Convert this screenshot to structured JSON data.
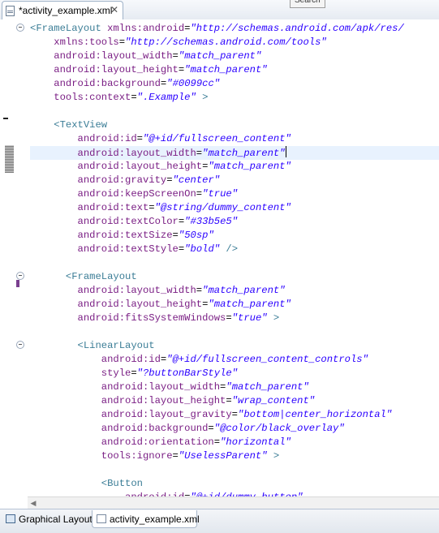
{
  "editor_tab": {
    "title": "*activity_example.xml",
    "close_glyph": "✕"
  },
  "search_tooltip": "Search",
  "code_lines": [
    [
      {
        "t": "tag",
        "v": "<FrameLayout "
      },
      {
        "t": "attr",
        "v": "xmlns:android"
      },
      {
        "t": "eq",
        "v": "="
      },
      {
        "t": "val",
        "v": "\"http://schemas.android.com/apk/res/"
      }
    ],
    [
      {
        "t": "sp",
        "v": "    "
      },
      {
        "t": "attr",
        "v": "xmlns:tools"
      },
      {
        "t": "eq",
        "v": "="
      },
      {
        "t": "val",
        "v": "\"http://schemas.android.com/tools\""
      }
    ],
    [
      {
        "t": "sp",
        "v": "    "
      },
      {
        "t": "attr",
        "v": "android:layout_width"
      },
      {
        "t": "eq",
        "v": "="
      },
      {
        "t": "val",
        "v": "\"match_parent\""
      }
    ],
    [
      {
        "t": "sp",
        "v": "    "
      },
      {
        "t": "attr",
        "v": "android:layout_height"
      },
      {
        "t": "eq",
        "v": "="
      },
      {
        "t": "val",
        "v": "\"match_parent\""
      }
    ],
    [
      {
        "t": "sp",
        "v": "    "
      },
      {
        "t": "attr",
        "v": "android:background"
      },
      {
        "t": "eq",
        "v": "="
      },
      {
        "t": "val",
        "v": "\"#0099cc\""
      }
    ],
    [
      {
        "t": "sp",
        "v": "    "
      },
      {
        "t": "attr",
        "v": "tools:context"
      },
      {
        "t": "eq",
        "v": "="
      },
      {
        "t": "val",
        "v": "\".Example\""
      },
      {
        "t": "tag",
        "v": " >"
      }
    ],
    [],
    [
      {
        "t": "sp",
        "v": "    "
      },
      {
        "t": "tag",
        "v": "<TextView"
      }
    ],
    [
      {
        "t": "sp",
        "v": "        "
      },
      {
        "t": "attr",
        "v": "android:id"
      },
      {
        "t": "eq",
        "v": "="
      },
      {
        "t": "val",
        "v": "\"@+id/fullscreen_content\""
      }
    ],
    [
      {
        "t": "sp",
        "v": "        "
      },
      {
        "t": "attr",
        "v": "android:layout_width"
      },
      {
        "t": "eq",
        "v": "="
      },
      {
        "t": "val",
        "v": "\"match_parent\""
      },
      {
        "t": "caret",
        "v": ""
      }
    ],
    [
      {
        "t": "sp",
        "v": "        "
      },
      {
        "t": "attr",
        "v": "android:layout_height"
      },
      {
        "t": "eq",
        "v": "="
      },
      {
        "t": "val",
        "v": "\"match_parent\""
      }
    ],
    [
      {
        "t": "sp",
        "v": "        "
      },
      {
        "t": "attr",
        "v": "android:gravity"
      },
      {
        "t": "eq",
        "v": "="
      },
      {
        "t": "val",
        "v": "\"center\""
      }
    ],
    [
      {
        "t": "sp",
        "v": "        "
      },
      {
        "t": "attr",
        "v": "android:keepScreenOn"
      },
      {
        "t": "eq",
        "v": "="
      },
      {
        "t": "val",
        "v": "\"true\""
      }
    ],
    [
      {
        "t": "sp",
        "v": "        "
      },
      {
        "t": "attr",
        "v": "android:text"
      },
      {
        "t": "eq",
        "v": "="
      },
      {
        "t": "val",
        "v": "\"@string/dummy_content\""
      }
    ],
    [
      {
        "t": "sp",
        "v": "        "
      },
      {
        "t": "attr",
        "v": "android:textColor"
      },
      {
        "t": "eq",
        "v": "="
      },
      {
        "t": "val",
        "v": "\"#33b5e5\""
      }
    ],
    [
      {
        "t": "sp",
        "v": "        "
      },
      {
        "t": "attr",
        "v": "android:textSize"
      },
      {
        "t": "eq",
        "v": "="
      },
      {
        "t": "val",
        "v": "\"50sp\""
      }
    ],
    [
      {
        "t": "sp",
        "v": "        "
      },
      {
        "t": "attr",
        "v": "android:textStyle"
      },
      {
        "t": "eq",
        "v": "="
      },
      {
        "t": "val",
        "v": "\"bold\""
      },
      {
        "t": "tag",
        "v": " />"
      }
    ],
    [],
    [
      {
        "t": "sp",
        "v": "      "
      },
      {
        "t": "tag",
        "v": "<FrameLayout"
      }
    ],
    [
      {
        "t": "sp",
        "v": "        "
      },
      {
        "t": "attr",
        "v": "android:layout_width"
      },
      {
        "t": "eq",
        "v": "="
      },
      {
        "t": "val",
        "v": "\"match_parent\""
      }
    ],
    [
      {
        "t": "sp",
        "v": "        "
      },
      {
        "t": "attr",
        "v": "android:layout_height"
      },
      {
        "t": "eq",
        "v": "="
      },
      {
        "t": "val",
        "v": "\"match_parent\""
      }
    ],
    [
      {
        "t": "sp",
        "v": "        "
      },
      {
        "t": "attr",
        "v": "android:fitsSystemWindows"
      },
      {
        "t": "eq",
        "v": "="
      },
      {
        "t": "val",
        "v": "\"true\""
      },
      {
        "t": "tag",
        "v": " >"
      }
    ],
    [],
    [
      {
        "t": "sp",
        "v": "        "
      },
      {
        "t": "tag",
        "v": "<LinearLayout"
      }
    ],
    [
      {
        "t": "sp",
        "v": "            "
      },
      {
        "t": "attr",
        "v": "android:id"
      },
      {
        "t": "eq",
        "v": "="
      },
      {
        "t": "val",
        "v": "\"@+id/fullscreen_content_controls\""
      }
    ],
    [
      {
        "t": "sp",
        "v": "            "
      },
      {
        "t": "attr",
        "v": "style"
      },
      {
        "t": "eq",
        "v": "="
      },
      {
        "t": "val",
        "v": "\"?buttonBarStyle\""
      }
    ],
    [
      {
        "t": "sp",
        "v": "            "
      },
      {
        "t": "attr",
        "v": "android:layout_width"
      },
      {
        "t": "eq",
        "v": "="
      },
      {
        "t": "val",
        "v": "\"match_parent\""
      }
    ],
    [
      {
        "t": "sp",
        "v": "            "
      },
      {
        "t": "attr",
        "v": "android:layout_height"
      },
      {
        "t": "eq",
        "v": "="
      },
      {
        "t": "val",
        "v": "\"wrap_content\""
      }
    ],
    [
      {
        "t": "sp",
        "v": "            "
      },
      {
        "t": "attr",
        "v": "android:layout_gravity"
      },
      {
        "t": "eq",
        "v": "="
      },
      {
        "t": "val",
        "v": "\"bottom|center_horizontal\""
      }
    ],
    [
      {
        "t": "sp",
        "v": "            "
      },
      {
        "t": "attr",
        "v": "android:background"
      },
      {
        "t": "eq",
        "v": "="
      },
      {
        "t": "val",
        "v": "\"@color/black_overlay\""
      }
    ],
    [
      {
        "t": "sp",
        "v": "            "
      },
      {
        "t": "attr",
        "v": "android:orientation"
      },
      {
        "t": "eq",
        "v": "="
      },
      {
        "t": "val",
        "v": "\"horizontal\""
      }
    ],
    [
      {
        "t": "sp",
        "v": "            "
      },
      {
        "t": "attr",
        "v": "tools:ignore"
      },
      {
        "t": "eq",
        "v": "="
      },
      {
        "t": "val",
        "v": "\"UselessParent\""
      },
      {
        "t": "tag",
        "v": " >"
      }
    ],
    [],
    [
      {
        "t": "sp",
        "v": "            "
      },
      {
        "t": "tag",
        "v": "<Button"
      }
    ],
    [
      {
        "t": "sp",
        "v": "                "
      },
      {
        "t": "attr",
        "v": "android:id"
      },
      {
        "t": "eq",
        "v": "="
      },
      {
        "t": "val",
        "v": "\"@+id/dummy_button\""
      }
    ]
  ],
  "current_line": 9,
  "bottom_tabs": [
    {
      "label": "Graphical Layout",
      "active": false
    },
    {
      "label": "activity_example.xml",
      "active": true
    }
  ],
  "colors": {
    "tag": "#3b7d96",
    "attribute": "#7a1e84",
    "value": "#2a00ff",
    "current_line": "#e8f2fe"
  }
}
